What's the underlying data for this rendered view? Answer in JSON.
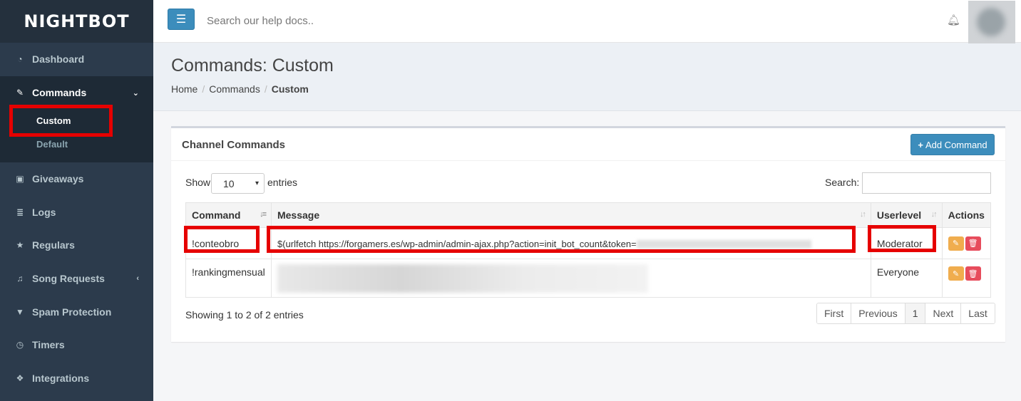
{
  "brand": {
    "logo_text": "NIGHTBOT"
  },
  "sidebar": {
    "items": [
      {
        "label": "Dashboard",
        "icon": "dashboard-icon"
      },
      {
        "label": "Commands",
        "icon": "wand-icon"
      },
      {
        "label": "Giveaways",
        "icon": "gift-icon"
      },
      {
        "label": "Logs",
        "icon": "database-icon"
      },
      {
        "label": "Regulars",
        "icon": "star-icon"
      },
      {
        "label": "Song Requests",
        "icon": "music-icon"
      },
      {
        "label": "Spam Protection",
        "icon": "filter-icon"
      },
      {
        "label": "Timers",
        "icon": "clock-icon"
      },
      {
        "label": "Integrations",
        "icon": "cubes-icon"
      }
    ],
    "commands_sub": [
      "Custom",
      "Default"
    ]
  },
  "header": {
    "search_placeholder": "Search our help docs.."
  },
  "page": {
    "title": "Commands: Custom",
    "breadcrumb": [
      "Home",
      "Commands",
      "Custom"
    ]
  },
  "box": {
    "title": "Channel Commands",
    "add_button": "Add Command",
    "show_label": "Show",
    "entries_value": "10",
    "entries_label": "entries",
    "search_label": "Search:"
  },
  "table": {
    "headers": [
      "Command",
      "Message",
      "Userlevel",
      "Actions"
    ],
    "rows": [
      {
        "command": "!conteobro",
        "message": "$(urlfetch https://forgamers.es/wp-admin/admin-ajax.php?action=init_bot_count&token=",
        "userlevel": "Moderator"
      },
      {
        "command": "!rankingmensual",
        "message": "",
        "userlevel": "Everyone"
      }
    ]
  },
  "footer": {
    "showing": "Showing 1 to 2 of 2 entries",
    "pager": [
      "First",
      "Previous",
      "1",
      "Next",
      "Last"
    ]
  },
  "colors": {
    "highlight": "#e60000",
    "primary": "#3c8dbc",
    "sidebar": "#2c3b4c"
  }
}
